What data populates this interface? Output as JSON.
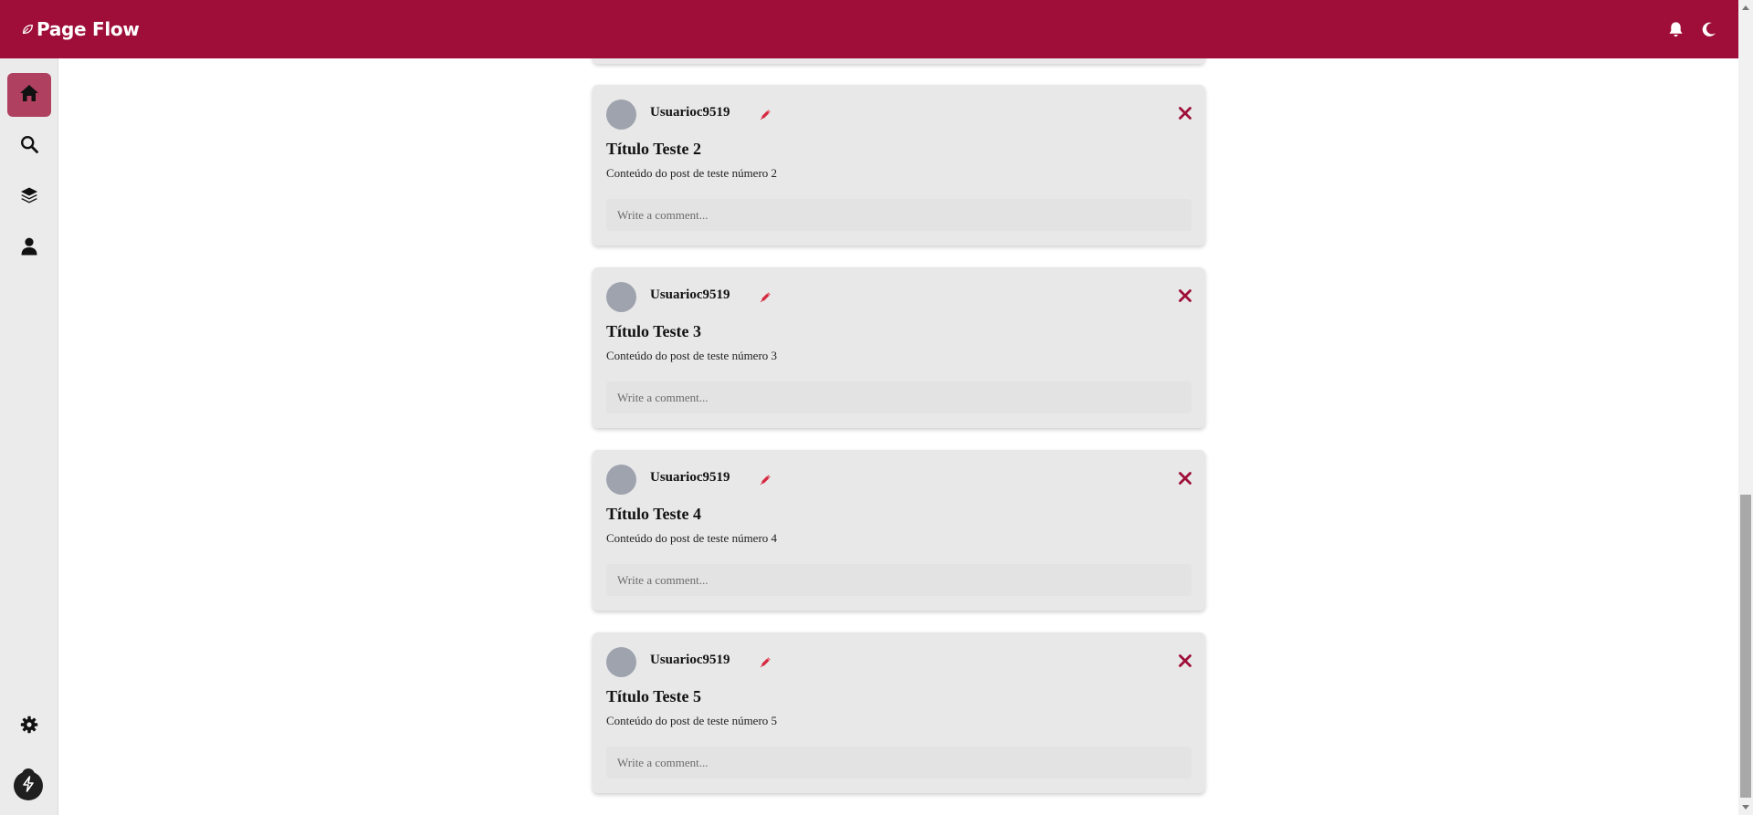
{
  "header": {
    "brand": "Page Flow",
    "bg_color": "#9e0e38"
  },
  "sidebar": {
    "items": [
      {
        "name": "home",
        "icon": "home-icon",
        "active": true
      },
      {
        "name": "search",
        "icon": "search-icon",
        "active": false
      },
      {
        "name": "layers",
        "icon": "layers-icon",
        "active": false
      },
      {
        "name": "profile",
        "icon": "user-icon",
        "active": false
      }
    ],
    "bottom": {
      "icon": "gear-icon"
    },
    "active_color": "#b0405f"
  },
  "posts": [
    {
      "username": "Usuarioc9519",
      "title": "Título Teste 2",
      "content": "Conteúdo do post de teste número 2",
      "comment_placeholder": "Write a comment..."
    },
    {
      "username": "Usuarioc9519",
      "title": "Título Teste 3",
      "content": "Conteúdo do post de teste número 3",
      "comment_placeholder": "Write a comment..."
    },
    {
      "username": "Usuarioc9519",
      "title": "Título Teste 4",
      "content": "Conteúdo do post de teste número 4",
      "comment_placeholder": "Write a comment..."
    },
    {
      "username": "Usuarioc9519",
      "title": "Título Teste 5",
      "content": "Conteúdo do post de teste número 5",
      "comment_placeholder": "Write a comment..."
    }
  ],
  "colors": {
    "accent": "#9e0e38",
    "edit_icon": "#d6283f",
    "card_bg": "#e8e8e8"
  }
}
